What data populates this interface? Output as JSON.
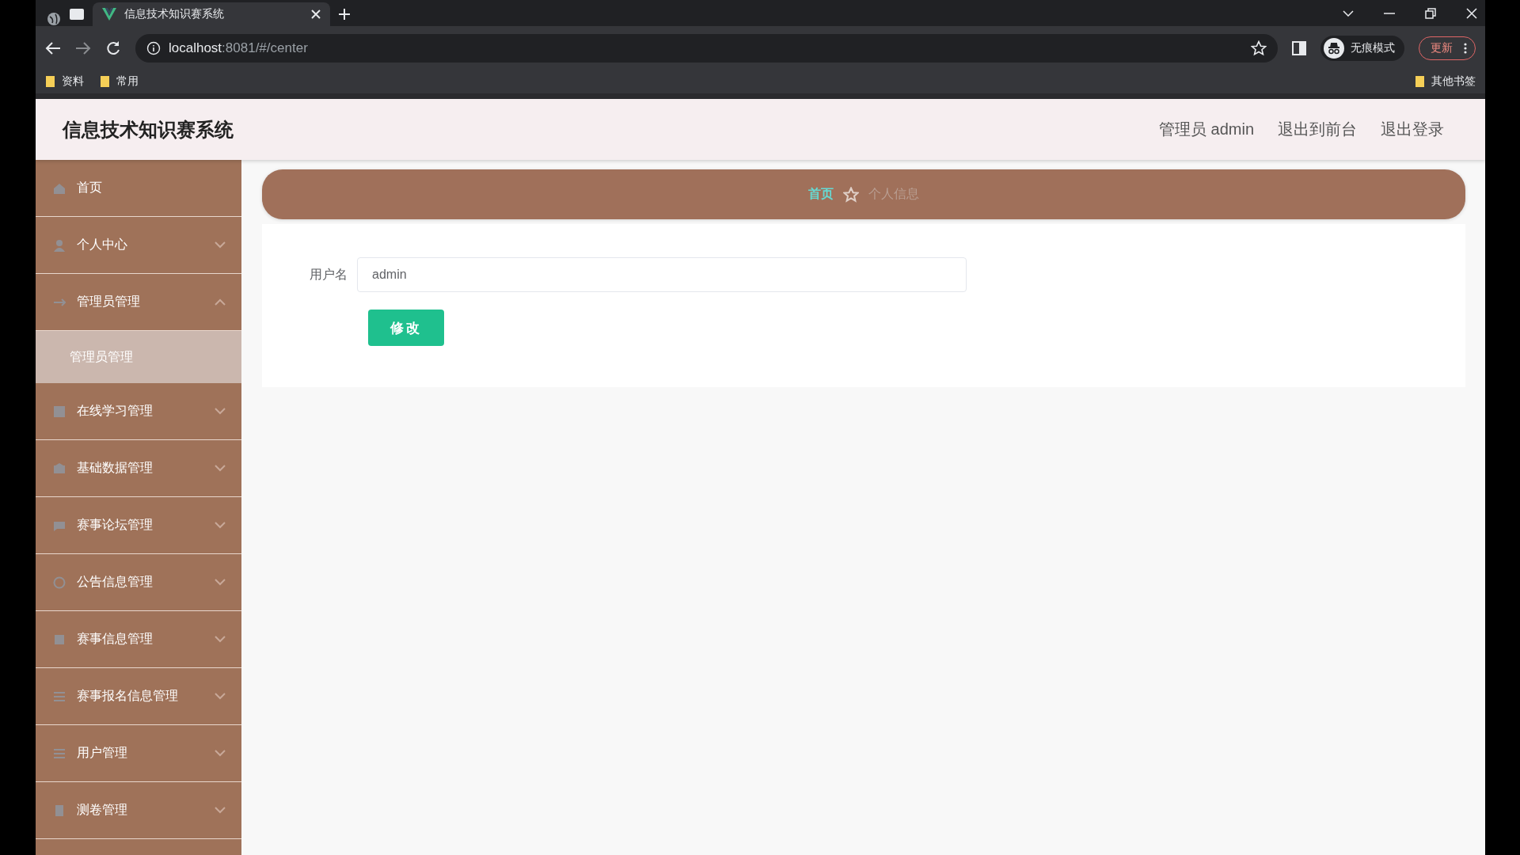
{
  "browser": {
    "tab_title": "信息技术知识赛系统",
    "url_host": "localhost",
    "url_rest": ":8081/#/center",
    "incognito_label": "无痕模式",
    "update_button": "更新",
    "bookmarks": [
      "资料",
      "常用"
    ],
    "other_bookmarks": "其他书签"
  },
  "header": {
    "title": "信息技术知识赛系统",
    "user": "管理员 admin",
    "links": [
      "退出到前台",
      "退出登录"
    ]
  },
  "sidebar": {
    "items": [
      {
        "label": "首页",
        "kind": "link"
      },
      {
        "label": "个人中心",
        "kind": "submenu",
        "expanded": false
      },
      {
        "label": "管理员管理",
        "kind": "submenu",
        "expanded": true,
        "children": [
          {
            "label": "管理员管理",
            "selected": true
          }
        ]
      },
      {
        "label": "在线学习管理",
        "kind": "submenu",
        "expanded": false
      },
      {
        "label": "基础数据管理",
        "kind": "submenu",
        "expanded": false
      },
      {
        "label": "赛事论坛管理",
        "kind": "submenu",
        "expanded": false
      },
      {
        "label": "公告信息管理",
        "kind": "submenu",
        "expanded": false
      },
      {
        "label": "赛事信息管理",
        "kind": "submenu",
        "expanded": false
      },
      {
        "label": "赛事报名信息管理",
        "kind": "submenu",
        "expanded": false
      },
      {
        "label": "用户管理",
        "kind": "submenu",
        "expanded": false
      },
      {
        "label": "测卷管理",
        "kind": "submenu",
        "expanded": false
      }
    ]
  },
  "breadcrumb": [
    "首页",
    "个人信息"
  ],
  "form": {
    "fields": [
      {
        "label": "用户名",
        "value": "admin"
      }
    ],
    "submit_button": "修改"
  }
}
